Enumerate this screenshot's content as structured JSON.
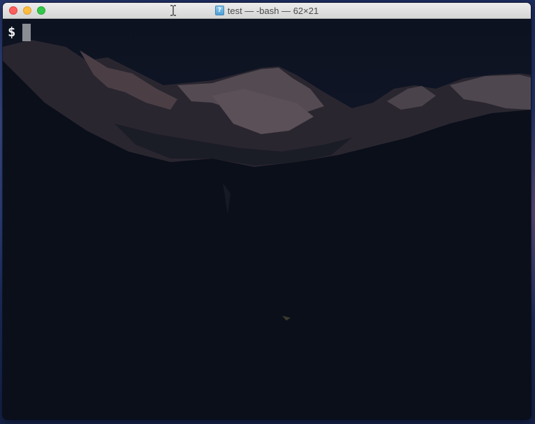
{
  "window": {
    "title": "test — -bash — 62×21",
    "title_icon": "terminal-document-icon",
    "title_icon_glyph": "?"
  },
  "terminal": {
    "prompt": "$",
    "background": "#060b14",
    "text_color": "#f2f2f2",
    "cursor_color": "#8a8d92"
  },
  "colors": {
    "close": "#fc605c",
    "minimize": "#fdbc40",
    "maximize": "#34c84a"
  }
}
